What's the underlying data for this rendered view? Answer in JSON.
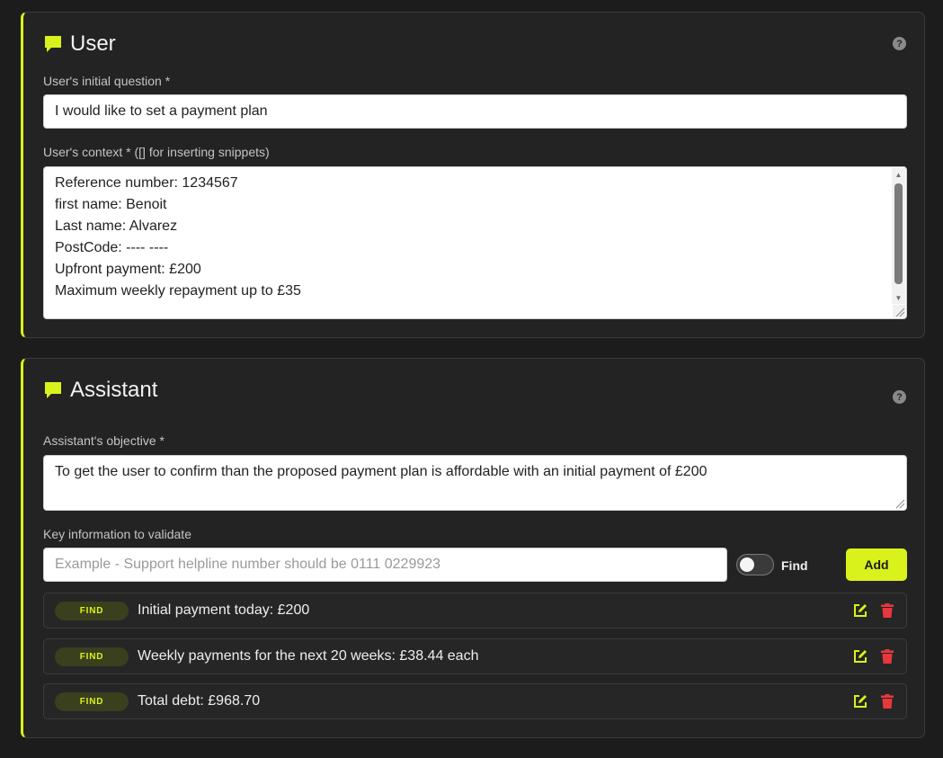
{
  "user": {
    "title": "User",
    "help": "?",
    "question_label": "User's initial question *",
    "question_value": "I would like to set a payment plan",
    "context_label": "User's context * ([] for inserting snippets)",
    "context_lines": [
      "Reference number: 1234567",
      "first name: Benoit",
      "Last name: Alvarez",
      "PostCode: ---- ----",
      "Upfront payment: £200",
      "Maximum weekly repayment up to £35"
    ]
  },
  "assistant": {
    "title": "Assistant",
    "help": "?",
    "objective_label": "Assistant's objective *",
    "objective_value": "To get the user to confirm than the proposed payment plan is affordable with an initial payment of £200",
    "key_info_label": "Key information to validate",
    "key_info_placeholder": "Example - Support helpline number should be 0111 0229923",
    "toggle_label": "Find",
    "toggle_on": false,
    "add_label": "Add",
    "items": [
      {
        "badge": "FIND",
        "text": "Initial payment today: £200"
      },
      {
        "badge": "FIND",
        "text": "Weekly payments for the next 20 weeks: £38.44 each"
      },
      {
        "badge": "FIND",
        "text": "Total debt: £968.70"
      }
    ]
  },
  "colors": {
    "accent": "#d9f21b",
    "background": "#1c1c1c",
    "card": "#232323",
    "delete": "#e8383d"
  },
  "icons": {
    "section": "chat-bubble-icon",
    "help": "help-icon",
    "edit": "edit-icon",
    "delete": "trash-icon"
  }
}
